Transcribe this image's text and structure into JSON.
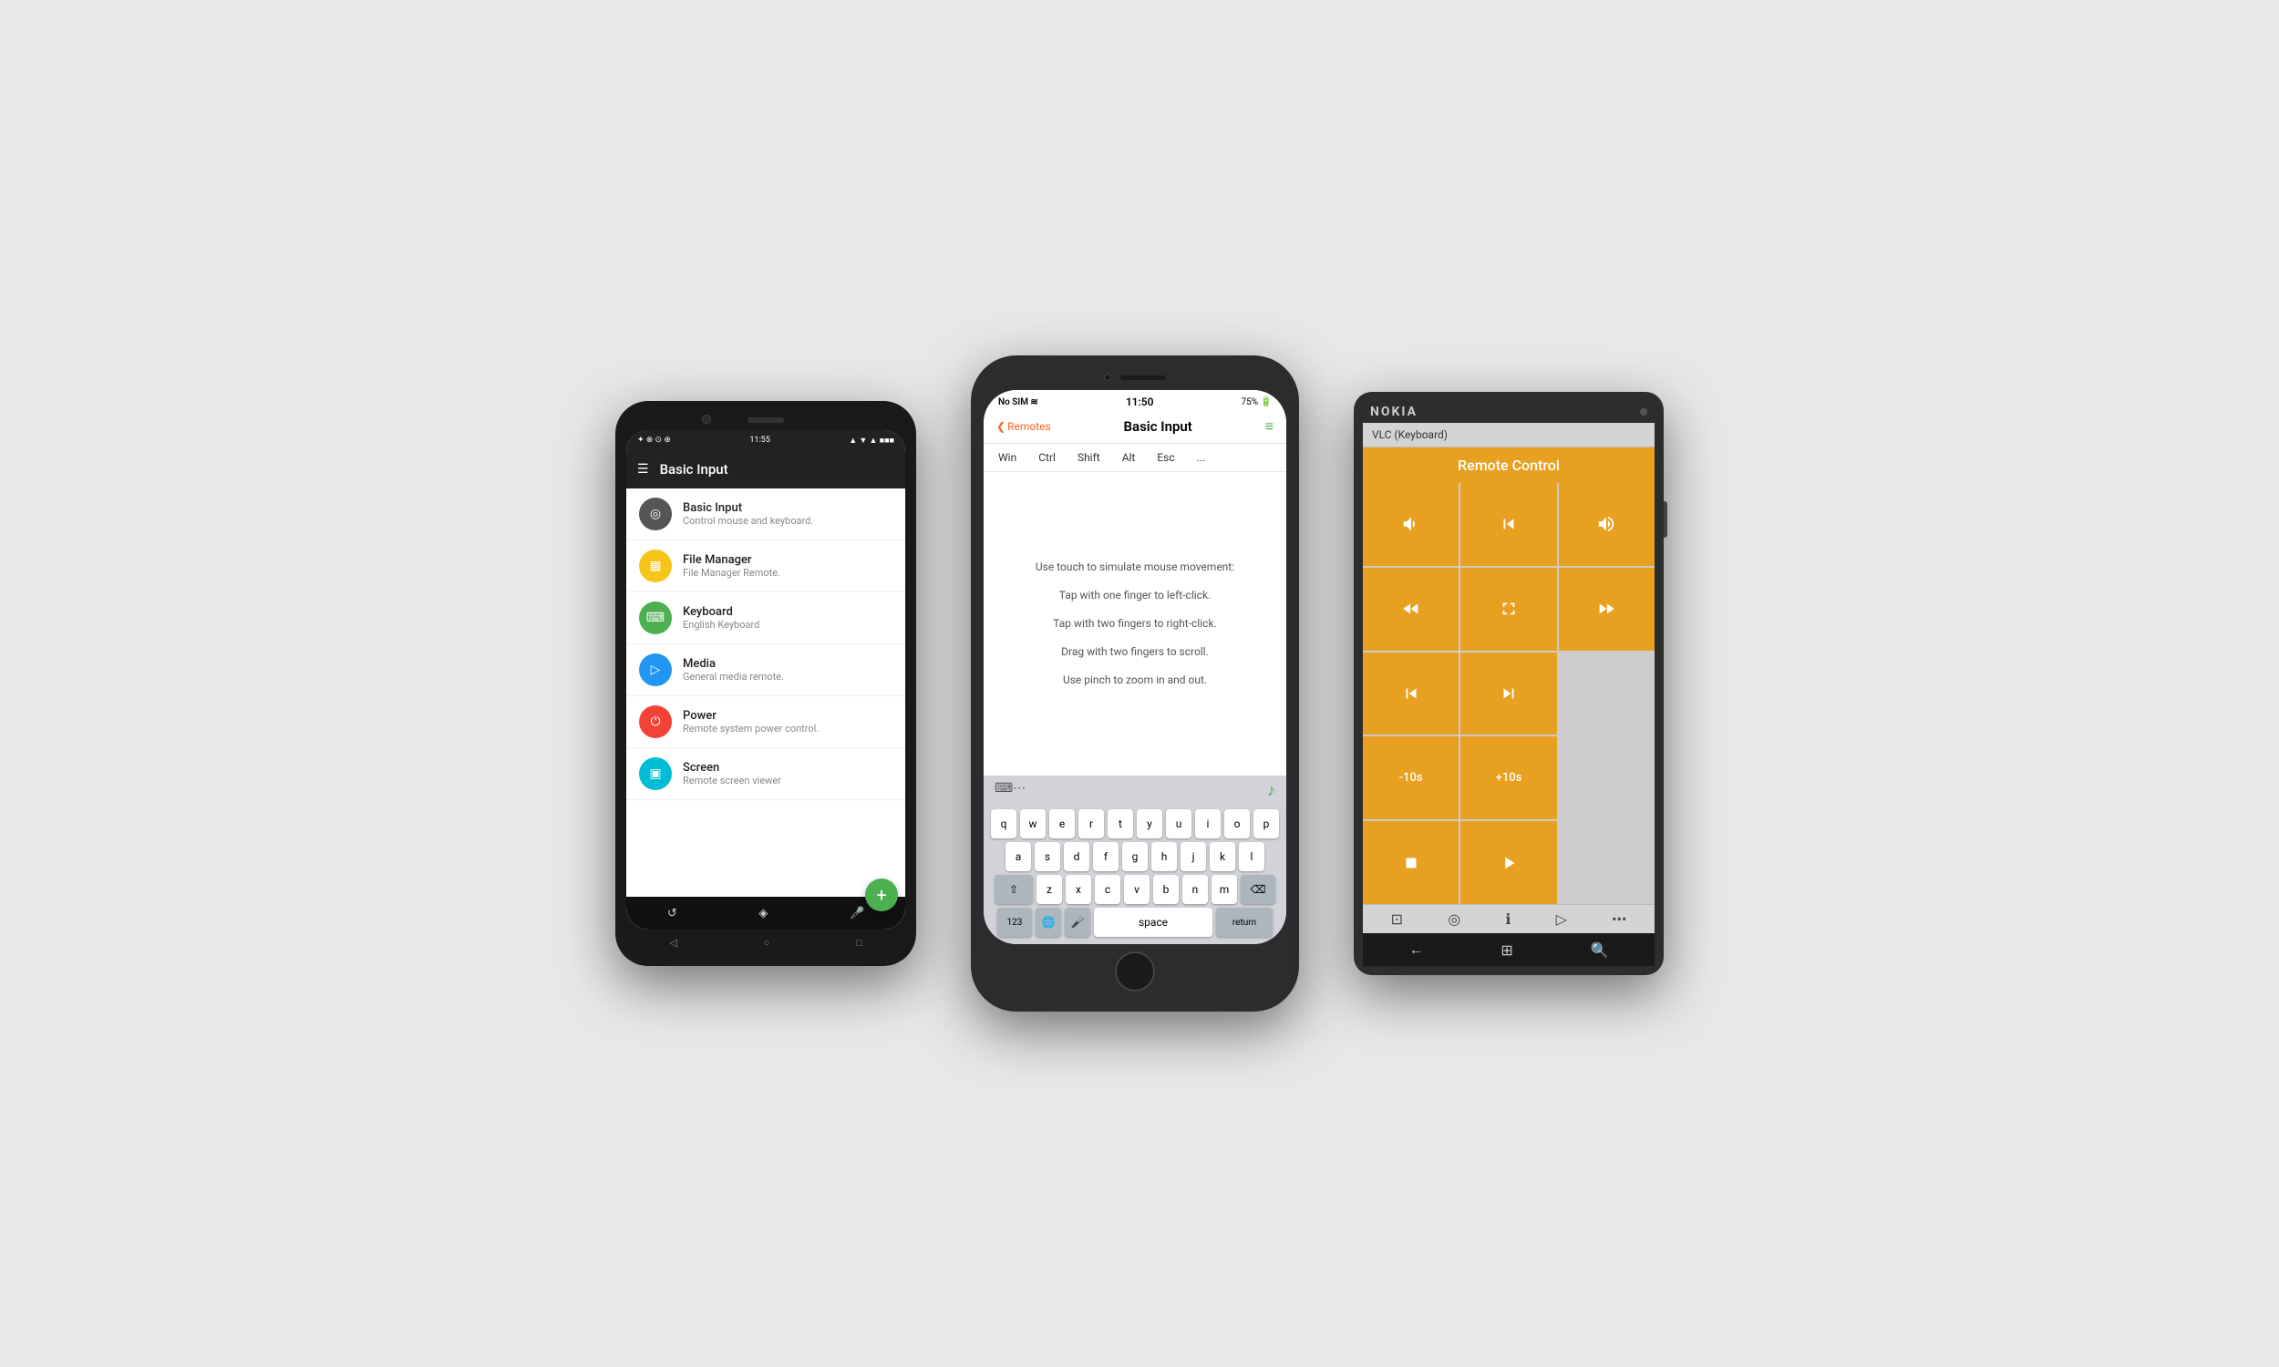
{
  "android": {
    "status_bar": {
      "left": "⊕ ⊗ ⊙ ◉",
      "time": "11:55",
      "right": "▲ ▼ ◆ ■ ■■■"
    },
    "toolbar": {
      "menu_icon": "☰",
      "title": "Basic Input"
    },
    "list_items": [
      {
        "icon_color": "#555555",
        "icon": "◎",
        "title": "Basic Input",
        "subtitle": "Control mouse and keyboard."
      },
      {
        "icon_color": "#f5c518",
        "icon": "▦",
        "title": "File Manager",
        "subtitle": "File Manager Remote."
      },
      {
        "icon_color": "#4CAF50",
        "icon": "⌨",
        "title": "Keyboard",
        "subtitle": "English Keyboard"
      },
      {
        "icon_color": "#2196F3",
        "icon": "▷",
        "title": "Media",
        "subtitle": "General media remote."
      },
      {
        "icon_color": "#f44336",
        "icon": "⏻",
        "title": "Power",
        "subtitle": "Remote system power control."
      },
      {
        "icon_color": "#00BCD4",
        "icon": "▣",
        "title": "Screen",
        "subtitle": "Remote screen viewer"
      }
    ],
    "fab_icon": "+",
    "nav_icons": [
      "↺",
      "◈",
      "🎤"
    ],
    "bottom_icons": [
      "◁",
      "○",
      "□"
    ]
  },
  "ios": {
    "status_bar": {
      "left": "No SIM ≋",
      "time": "11:50",
      "right": "75% 🔋"
    },
    "nav": {
      "back_icon": "❮",
      "back_label": "Remotes",
      "title": "Basic Input",
      "menu_icon": "≡"
    },
    "modifiers": [
      "Win",
      "Ctrl",
      "Shift",
      "Alt",
      "Esc",
      "..."
    ],
    "content": {
      "line1": "Use touch to simulate mouse movement:",
      "line2": "Tap with one finger to left-click.",
      "line3": "Tap with two fingers to right-click.",
      "line4": "Drag with two fingers to scroll.",
      "line5": "Use pinch to zoom in and out."
    },
    "keyboard": {
      "row1": [
        "q",
        "w",
        "e",
        "r",
        "t",
        "y",
        "u",
        "i",
        "o",
        "p"
      ],
      "row2": [
        "a",
        "s",
        "d",
        "f",
        "g",
        "h",
        "j",
        "k",
        "l"
      ],
      "row3": [
        "z",
        "x",
        "c",
        "v",
        "b",
        "n",
        "m"
      ],
      "bottom": [
        "123",
        "🌐",
        "🎤",
        "space",
        "return"
      ]
    }
  },
  "nokia": {
    "brand": "NOKIA",
    "title_bar": "VLC (Keyboard)",
    "remote_title": "Remote Control",
    "buttons": [
      {
        "icon": "◄◄",
        "type": "vol_down"
      },
      {
        "icon": "◄",
        "type": "prev_track"
      },
      {
        "icon": "►◄",
        "type": "vol_up"
      },
      {
        "icon": "◄◄",
        "type": "rewind"
      },
      {
        "icon": "⛶",
        "type": "fullscreen"
      },
      {
        "icon": "►►",
        "type": "fastforward"
      },
      {
        "icon": "|◄",
        "type": "skip_back"
      },
      {
        "icon": "►|",
        "type": "skip_forward"
      },
      {
        "icon": "-10s",
        "type": "minus10",
        "text": true
      },
      {
        "icon": "+10s",
        "type": "plus10",
        "text": true
      },
      {
        "icon": "■",
        "type": "stop"
      },
      {
        "icon": "▶",
        "type": "play"
      }
    ],
    "bottom_icons": [
      "⊡",
      "◎",
      "ℹ",
      "▷",
      "•••"
    ],
    "win_nav": [
      "←",
      "⊞",
      "🔍"
    ]
  }
}
